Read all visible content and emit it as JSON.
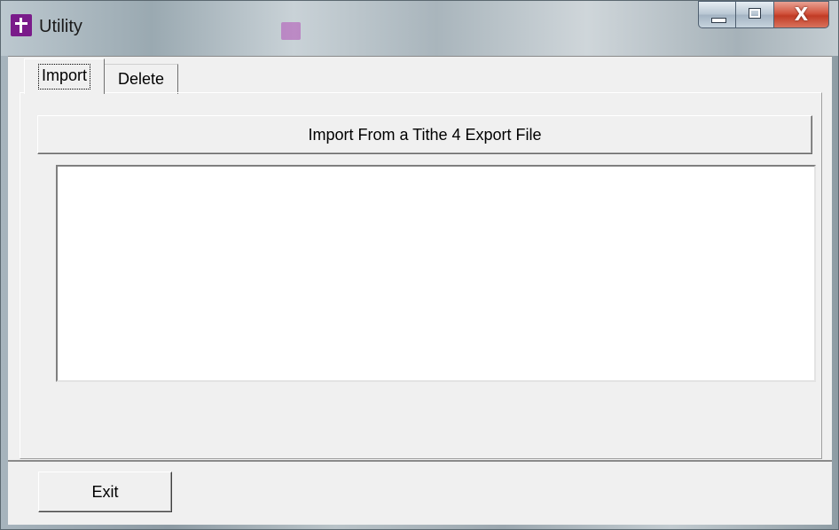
{
  "window": {
    "title": "Utility",
    "close_glyph": "X",
    "icons": {
      "app": "cross-icon",
      "minimize": "minimize-icon",
      "maximize": "maximize-icon",
      "close": "close-icon"
    }
  },
  "tabs": [
    {
      "label": "Import",
      "active": true
    },
    {
      "label": "Delete",
      "active": false
    }
  ],
  "import_tab": {
    "import_button_label": "Import From a Tithe 4 Export File",
    "log_items": []
  },
  "footer": {
    "exit_label": "Exit"
  },
  "colors": {
    "app_icon": "#7a1b8a",
    "close_button": "#c13b25",
    "face": "#f0f0f0"
  }
}
